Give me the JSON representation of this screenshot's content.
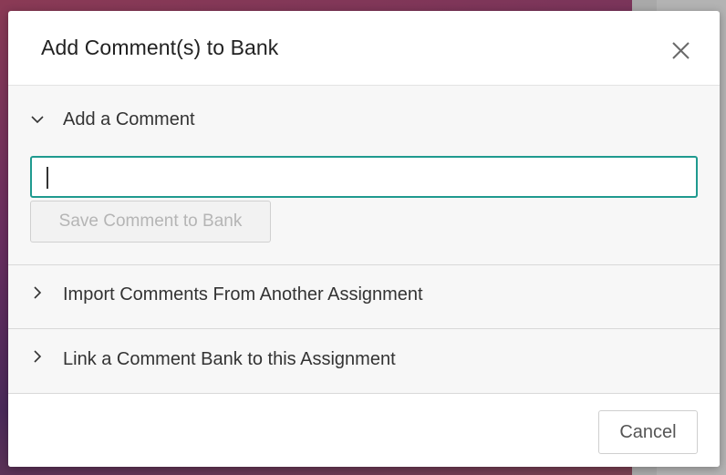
{
  "modal": {
    "title": "Add Comment(s) to Bank",
    "close_icon": "close-icon"
  },
  "sections": [
    {
      "label": "Add a Comment",
      "expanded": true,
      "icon": "chevron-down-icon"
    },
    {
      "label": "Import Comments From Another Assignment",
      "expanded": false,
      "icon": "chevron-right-icon"
    },
    {
      "label": "Link a Comment Bank to this Assignment",
      "expanded": false,
      "icon": "chevron-right-icon"
    }
  ],
  "comment_input": {
    "value": "",
    "placeholder": ""
  },
  "save_button": {
    "label": "Save Comment to Bank",
    "disabled": true
  },
  "footer": {
    "cancel_label": "Cancel"
  },
  "colors": {
    "accent": "#1f9a8f",
    "text": "#333333",
    "disabled_text": "#b5b5b5"
  }
}
